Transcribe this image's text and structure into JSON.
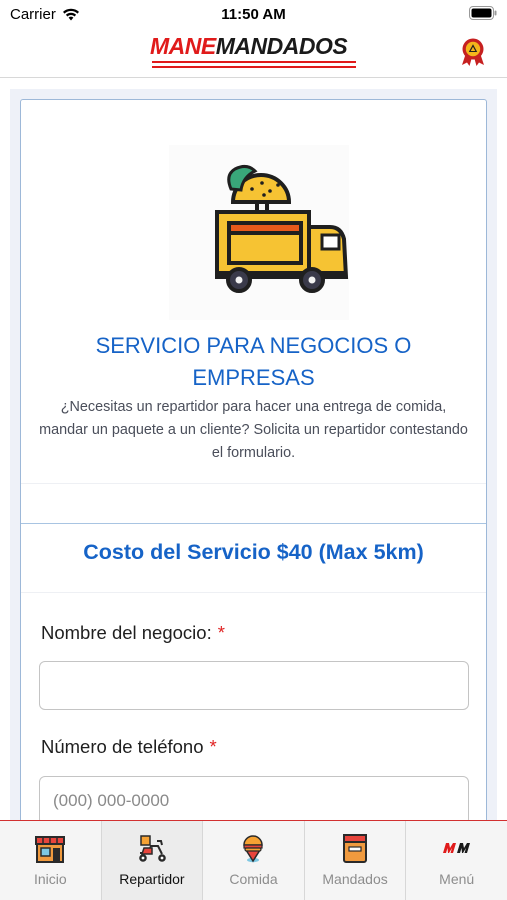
{
  "status": {
    "carrier": "Carrier",
    "time": "11:50 AM"
  },
  "header": {
    "brand_part1": "MANE",
    "brand_part2": "MANDADOS",
    "badge_icon": "award-badge-icon"
  },
  "hero": {
    "image_icon": "food-truck-icon",
    "title": "SERVICIO PARA NEGOCIOS O EMPRESAS",
    "description": "¿Necesitas un repartidor para hacer una entrega de comida, mandar un paquete a un cliente? Solicita un repartidor contestando el formulario."
  },
  "form": {
    "cost_title": "Costo del Servicio $40 (Max 5km)",
    "fields": [
      {
        "label": "Nombre del negocio:",
        "required_mark": "*",
        "value": "",
        "placeholder": ""
      },
      {
        "label": "Número de teléfono",
        "required_mark": "*",
        "value": "",
        "placeholder": "(000) 000-0000"
      }
    ]
  },
  "tabs": [
    {
      "label": "Inicio",
      "icon": "store-icon",
      "active": false
    },
    {
      "label": "Repartidor",
      "icon": "scooter-icon",
      "active": true
    },
    {
      "label": "Comida",
      "icon": "food-pin-icon",
      "active": false
    },
    {
      "label": "Mandados",
      "icon": "package-icon",
      "active": false
    },
    {
      "label": "Menú",
      "icon": "mm-logo-icon",
      "active": false
    }
  ],
  "colors": {
    "brand_red": "#e01b1b",
    "accent_blue": "#1663c7",
    "truck_yellow": "#f6c333"
  }
}
